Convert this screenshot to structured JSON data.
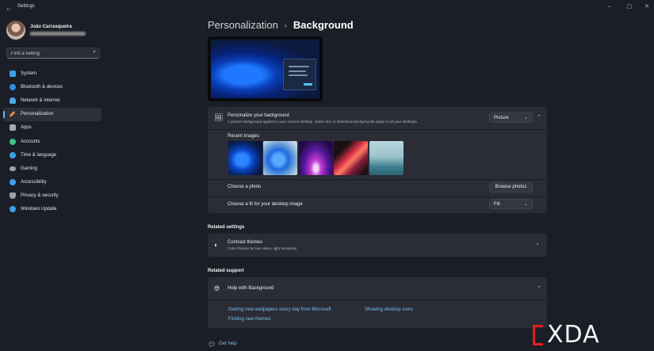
{
  "window": {
    "title": "Settings",
    "back_icon": "back-arrow-icon",
    "controls": [
      "minimize-icon",
      "maximize-icon",
      "close-icon"
    ]
  },
  "profile": {
    "name": "João Carrasqueira"
  },
  "search": {
    "placeholder": "Find a setting",
    "icon": "search-icon"
  },
  "sidebar": {
    "items": [
      {
        "label": "System",
        "icon": "system-display-icon",
        "color": "#3aa0e8"
      },
      {
        "label": "Bluetooth & devices",
        "icon": "bluetooth-icon",
        "color": "#2e8fe0"
      },
      {
        "label": "Network & internet",
        "icon": "wifi-icon",
        "color": "#4fa8e8"
      },
      {
        "label": "Personalization",
        "icon": "brush-icon",
        "color": "#e8864f",
        "active": true
      },
      {
        "label": "Apps",
        "icon": "apps-icon",
        "color": "#a4a8b5"
      },
      {
        "label": "Accounts",
        "icon": "accounts-icon",
        "color": "#3fc08a"
      },
      {
        "label": "Time & language",
        "icon": "globe-clock-icon",
        "color": "#3aa0e8"
      },
      {
        "label": "Gaming",
        "icon": "gamepad-icon",
        "color": "#9aa0ad"
      },
      {
        "label": "Accessibility",
        "icon": "accessibility-icon",
        "color": "#3aa0e8"
      },
      {
        "label": "Privacy & security",
        "icon": "shield-icon",
        "color": "#9aa0ad"
      },
      {
        "label": "Windows Update",
        "icon": "windows-update-icon",
        "color": "#3aa0e8"
      }
    ]
  },
  "breadcrumb": {
    "parent": "Personalization",
    "separator": "›",
    "current": "Background"
  },
  "background_card": {
    "title": "Personalize your background",
    "subtitle": "A picture background applies to your current desktop. Solid color or slideshow backgrounds apply to all your desktops.",
    "icon": "image-icon",
    "type_dropdown": "Picture",
    "recent_images_label": "Recent images",
    "recent_images": [
      "blue-bloom-dark",
      "blue-bloom-light",
      "purple-glow",
      "red-flower",
      "sea-horizon"
    ],
    "choose_photo_label": "Choose a photo",
    "browse_button": "Browse photos",
    "fit_label": "Choose a fit for your desktop image",
    "fit_dropdown": "Fill"
  },
  "related_settings": {
    "heading": "Related settings",
    "contrast_title": "Contrast themes",
    "contrast_subtitle": "Color themes for low vision, light sensitivity",
    "contrast_icon": "contrast-icon"
  },
  "related_support": {
    "heading": "Related support",
    "help_title": "Help with Background",
    "help_icon": "globe-icon",
    "links": [
      "Getting new wallpapers every day from Microsoft",
      "Showing desktop icons",
      "Finding new themes"
    ]
  },
  "get_help": {
    "label": "Get help",
    "icon": "help-icon"
  },
  "watermark": {
    "text": "XDA",
    "accent": "#e01f26"
  },
  "colors": {
    "background": "#1c1e27",
    "card": "#2a2c36",
    "accent": "#4fc3f7",
    "link": "#79bff2"
  }
}
